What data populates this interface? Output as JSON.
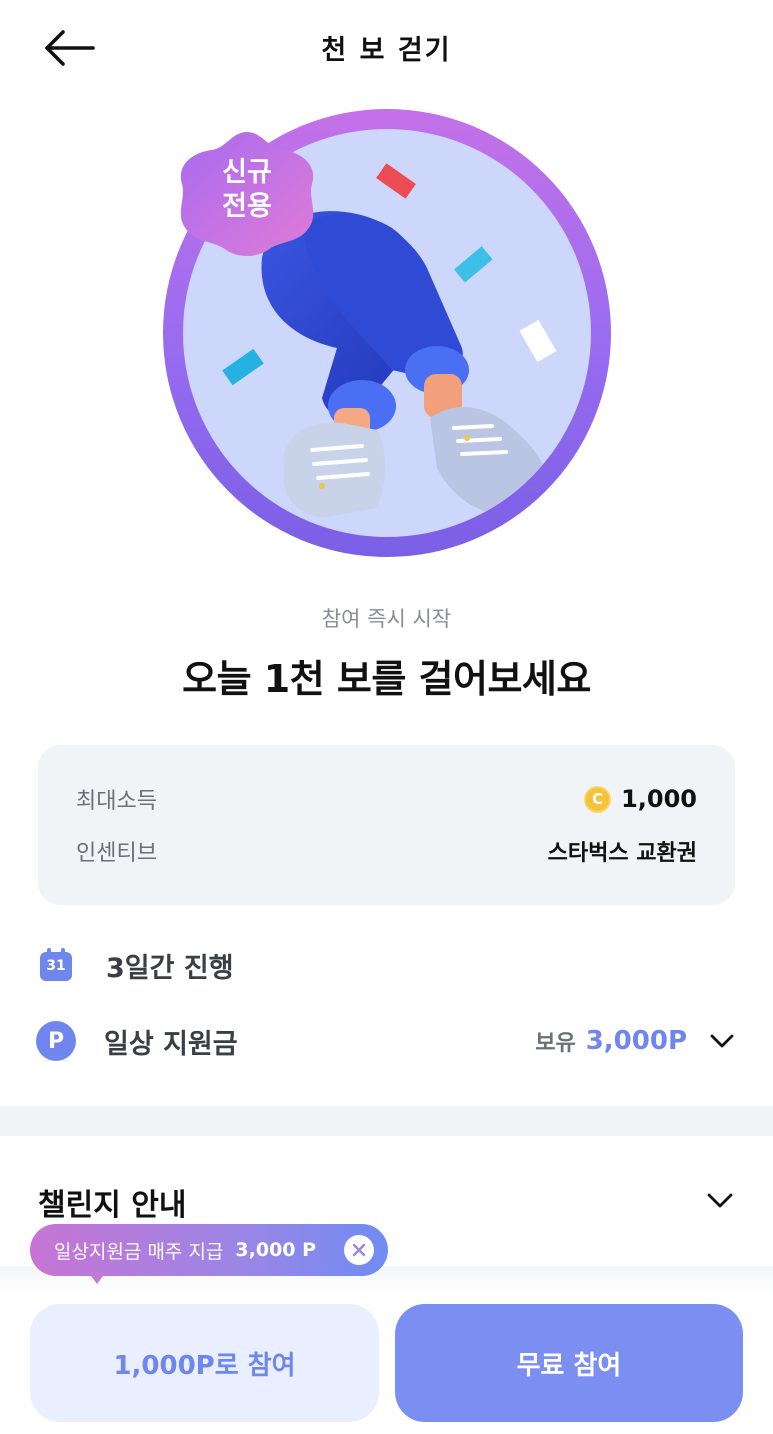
{
  "header": {
    "title": "천 보 걷기",
    "back_icon": "arrow-left-icon"
  },
  "hero": {
    "badge_line1": "신규",
    "badge_line2": "전용",
    "image": "walking-legs-illustration"
  },
  "intro": {
    "subtitle": "참여 즉시 시작",
    "title": "오늘 1천 보를 걸어보세요"
  },
  "info": {
    "max_income_label": "최대소득",
    "max_income_coin": "C",
    "max_income_value": "1,000",
    "incentive_label": "인센티브",
    "incentive_value": "스타벅스 교환권"
  },
  "features": {
    "duration_icon_text": "31",
    "duration_text": "3일간 진행",
    "support_icon_text": "P",
    "support_text": "일상 지원금",
    "own_label": "보유",
    "own_value": "3,000P"
  },
  "guide": {
    "title": "챌린지 안내"
  },
  "tooltip": {
    "text": "일상지원금 매주 지급",
    "amount": "3,000 P"
  },
  "buttons": {
    "paid_label": "1,000P로 참여",
    "free_label": "무료 참여"
  },
  "colors": {
    "accent": "#7b8ff2",
    "ring": "#9b6cf0",
    "coin": "#f4c33a",
    "card_bg": "#f2f3f6"
  }
}
